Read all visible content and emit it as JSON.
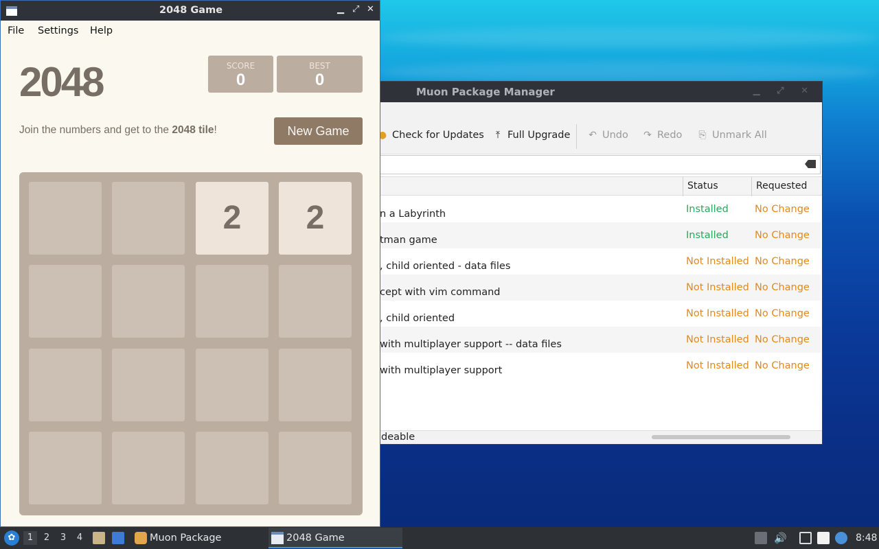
{
  "game_window": {
    "title": "2048 Game",
    "controls": [
      "▁",
      "⤢",
      "✕"
    ],
    "menu": [
      "File",
      "Settings",
      "Help"
    ],
    "heading": "2048",
    "score": {
      "label": "SCORE",
      "value": "0"
    },
    "best": {
      "label": "BEST",
      "value": "0"
    },
    "intro_prefix": "Join the numbers and get to the ",
    "intro_bold": "2048 tile",
    "intro_suffix": "!",
    "new_game": "New Game",
    "board": [
      [
        "",
        "",
        "2",
        "2"
      ],
      [
        "",
        "",
        "",
        ""
      ],
      [
        "",
        "",
        "",
        ""
      ],
      [
        "",
        "",
        "",
        ""
      ]
    ]
  },
  "muon_window": {
    "title": "Muon Package Manager",
    "toolbar": {
      "check_updates": "Check for Updates",
      "full_upgrade": "Full Upgrade",
      "undo": "Undo",
      "redo": "Redo",
      "unmark_all": "Unmark All"
    },
    "columns": {
      "status": "Status",
      "requested": "Requested"
    },
    "rows": [
      {
        "name": "n a Labyrinth",
        "status": "Installed",
        "requested": "No Change"
      },
      {
        "name": "tman game",
        "status": "Installed",
        "requested": "No Change"
      },
      {
        "name": ", child oriented - data files",
        "status": "Not Installed",
        "requested": "No Change"
      },
      {
        "name": "cept with vim command",
        "status": "Not Installed",
        "requested": "No Change"
      },
      {
        "name": ", child oriented",
        "status": "Not Installed",
        "requested": "No Change"
      },
      {
        "name": " with multiplayer support -- data files",
        "status": "Not Installed",
        "requested": "No Change"
      },
      {
        "name": " with multiplayer support",
        "status": "Not Installed",
        "requested": "No Change"
      }
    ],
    "statusbar": "deable"
  },
  "taskbar": {
    "workspaces": [
      "1",
      "2",
      "3",
      "4"
    ],
    "tasks": [
      "Muon Package Manager",
      "2048 Game"
    ],
    "clock": "8:48"
  },
  "colors": {
    "tile_bg": "#eee4da",
    "board_bg": "#bbada0",
    "installed": "#2ea45c",
    "not_installed": "#e3891a"
  }
}
